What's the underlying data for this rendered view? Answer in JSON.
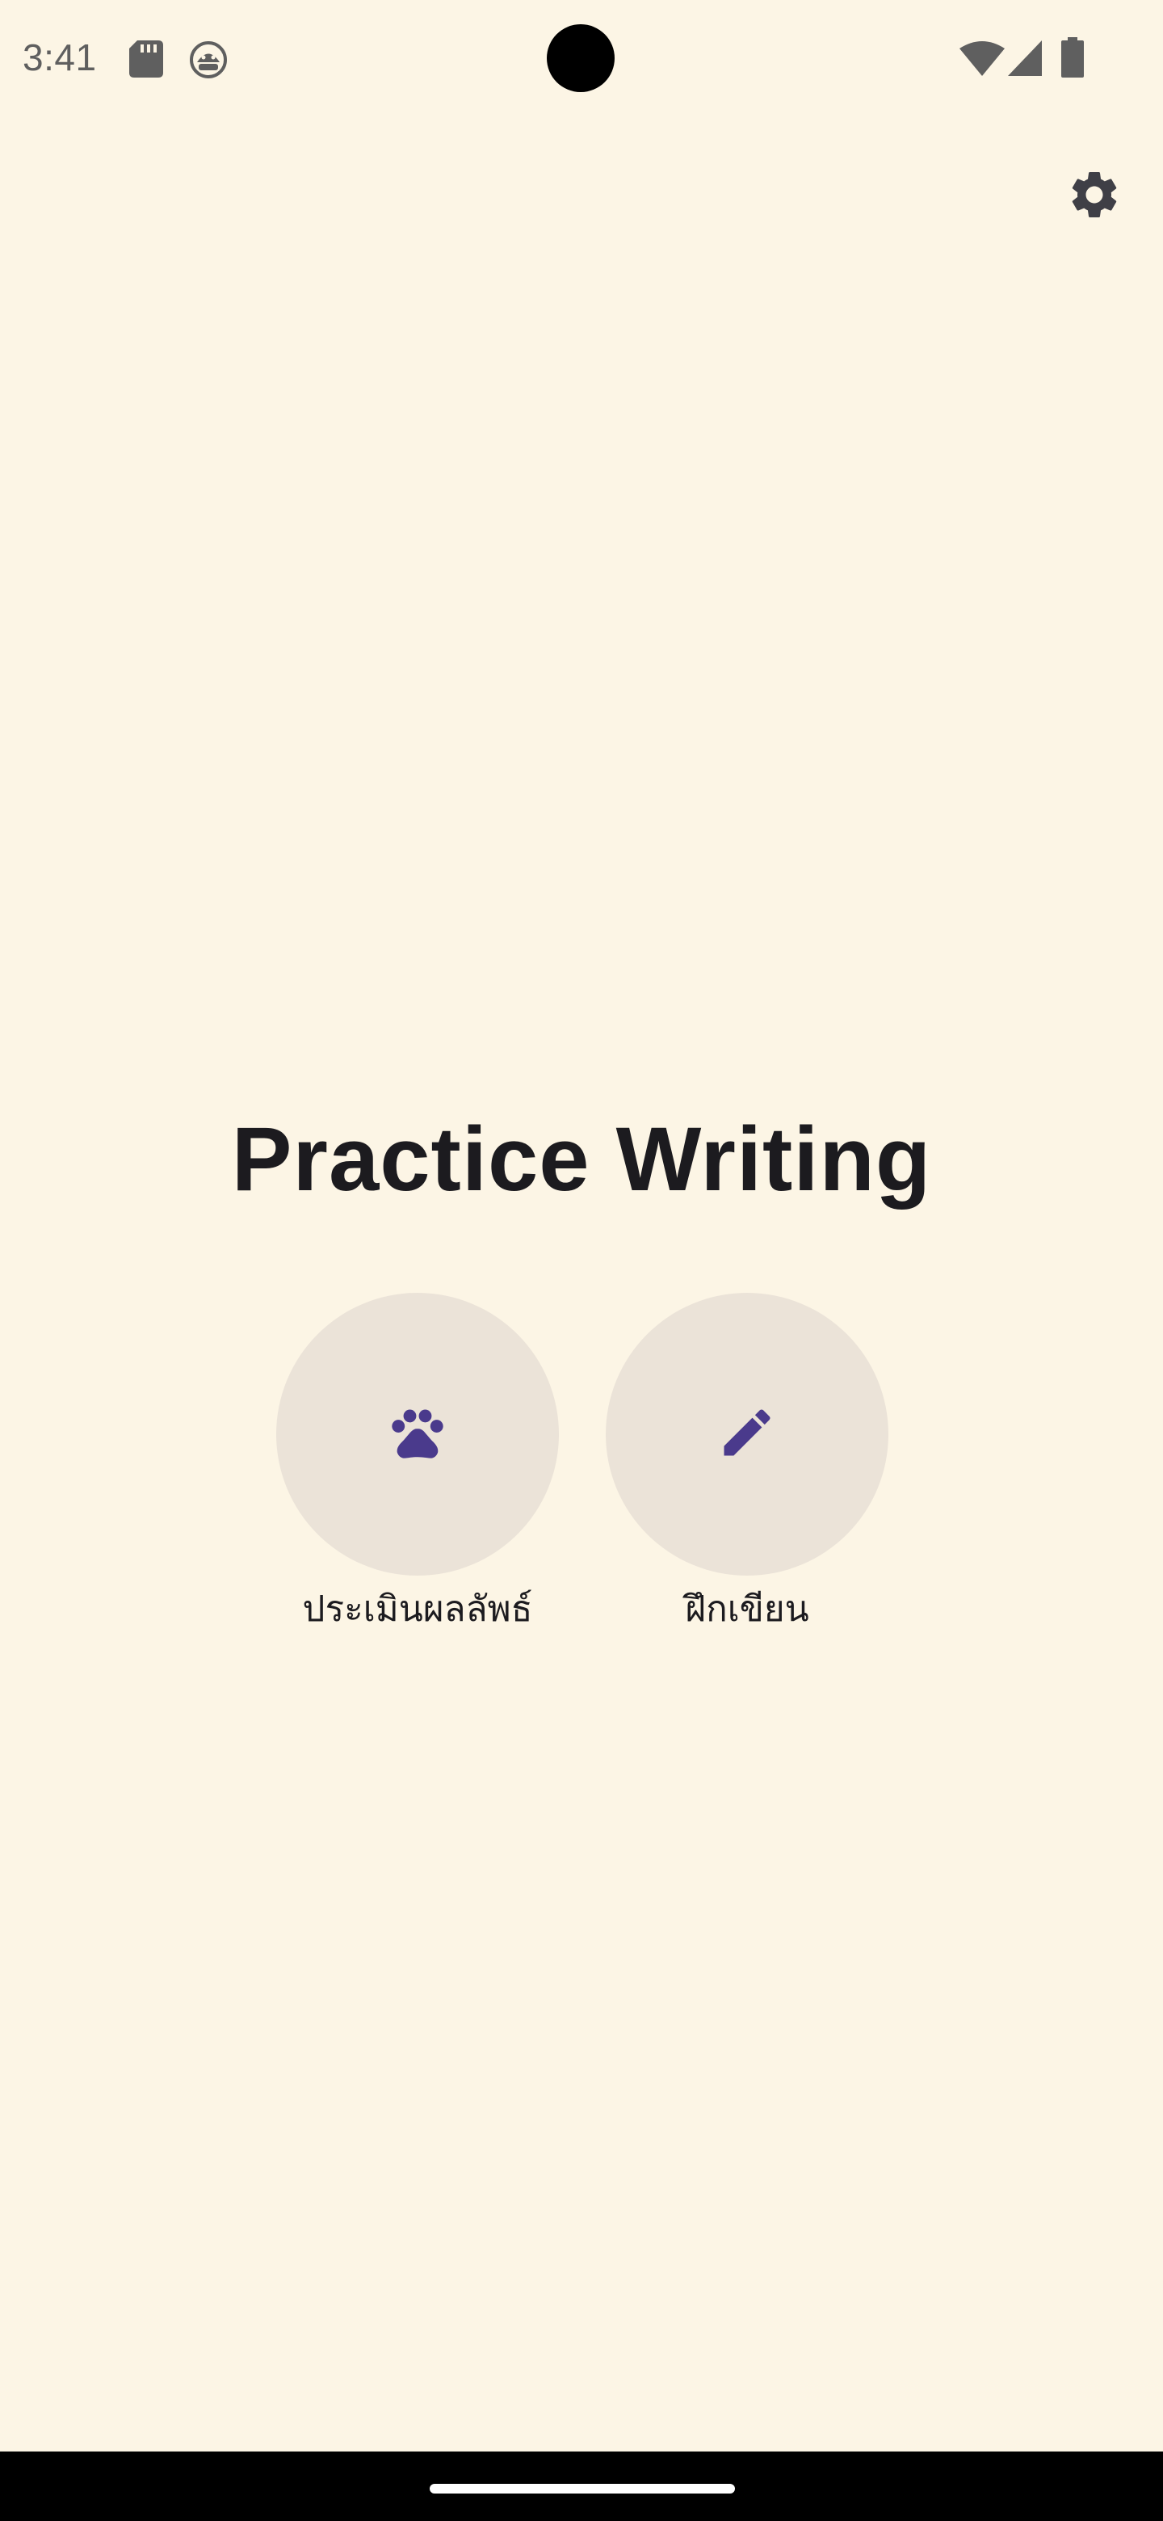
{
  "status_bar": {
    "time": "3:41",
    "icons": [
      "sd-card-icon",
      "android-debug-icon",
      "wifi-icon",
      "cell-signal-icon",
      "battery-icon"
    ]
  },
  "toolbar": {
    "settings_icon": "gear-icon"
  },
  "main": {
    "title": "Practice Writing",
    "actions": [
      {
        "label": "ประเมินผลลัพธ์",
        "icon": "paw-icon"
      },
      {
        "label": "ฝึกเขียน",
        "icon": "pencil-icon"
      }
    ]
  },
  "colors": {
    "background": "#fcf5e5",
    "button_fill": "#ebe3d8",
    "accent": "#4a3a8c",
    "text": "#1c1b1f"
  }
}
